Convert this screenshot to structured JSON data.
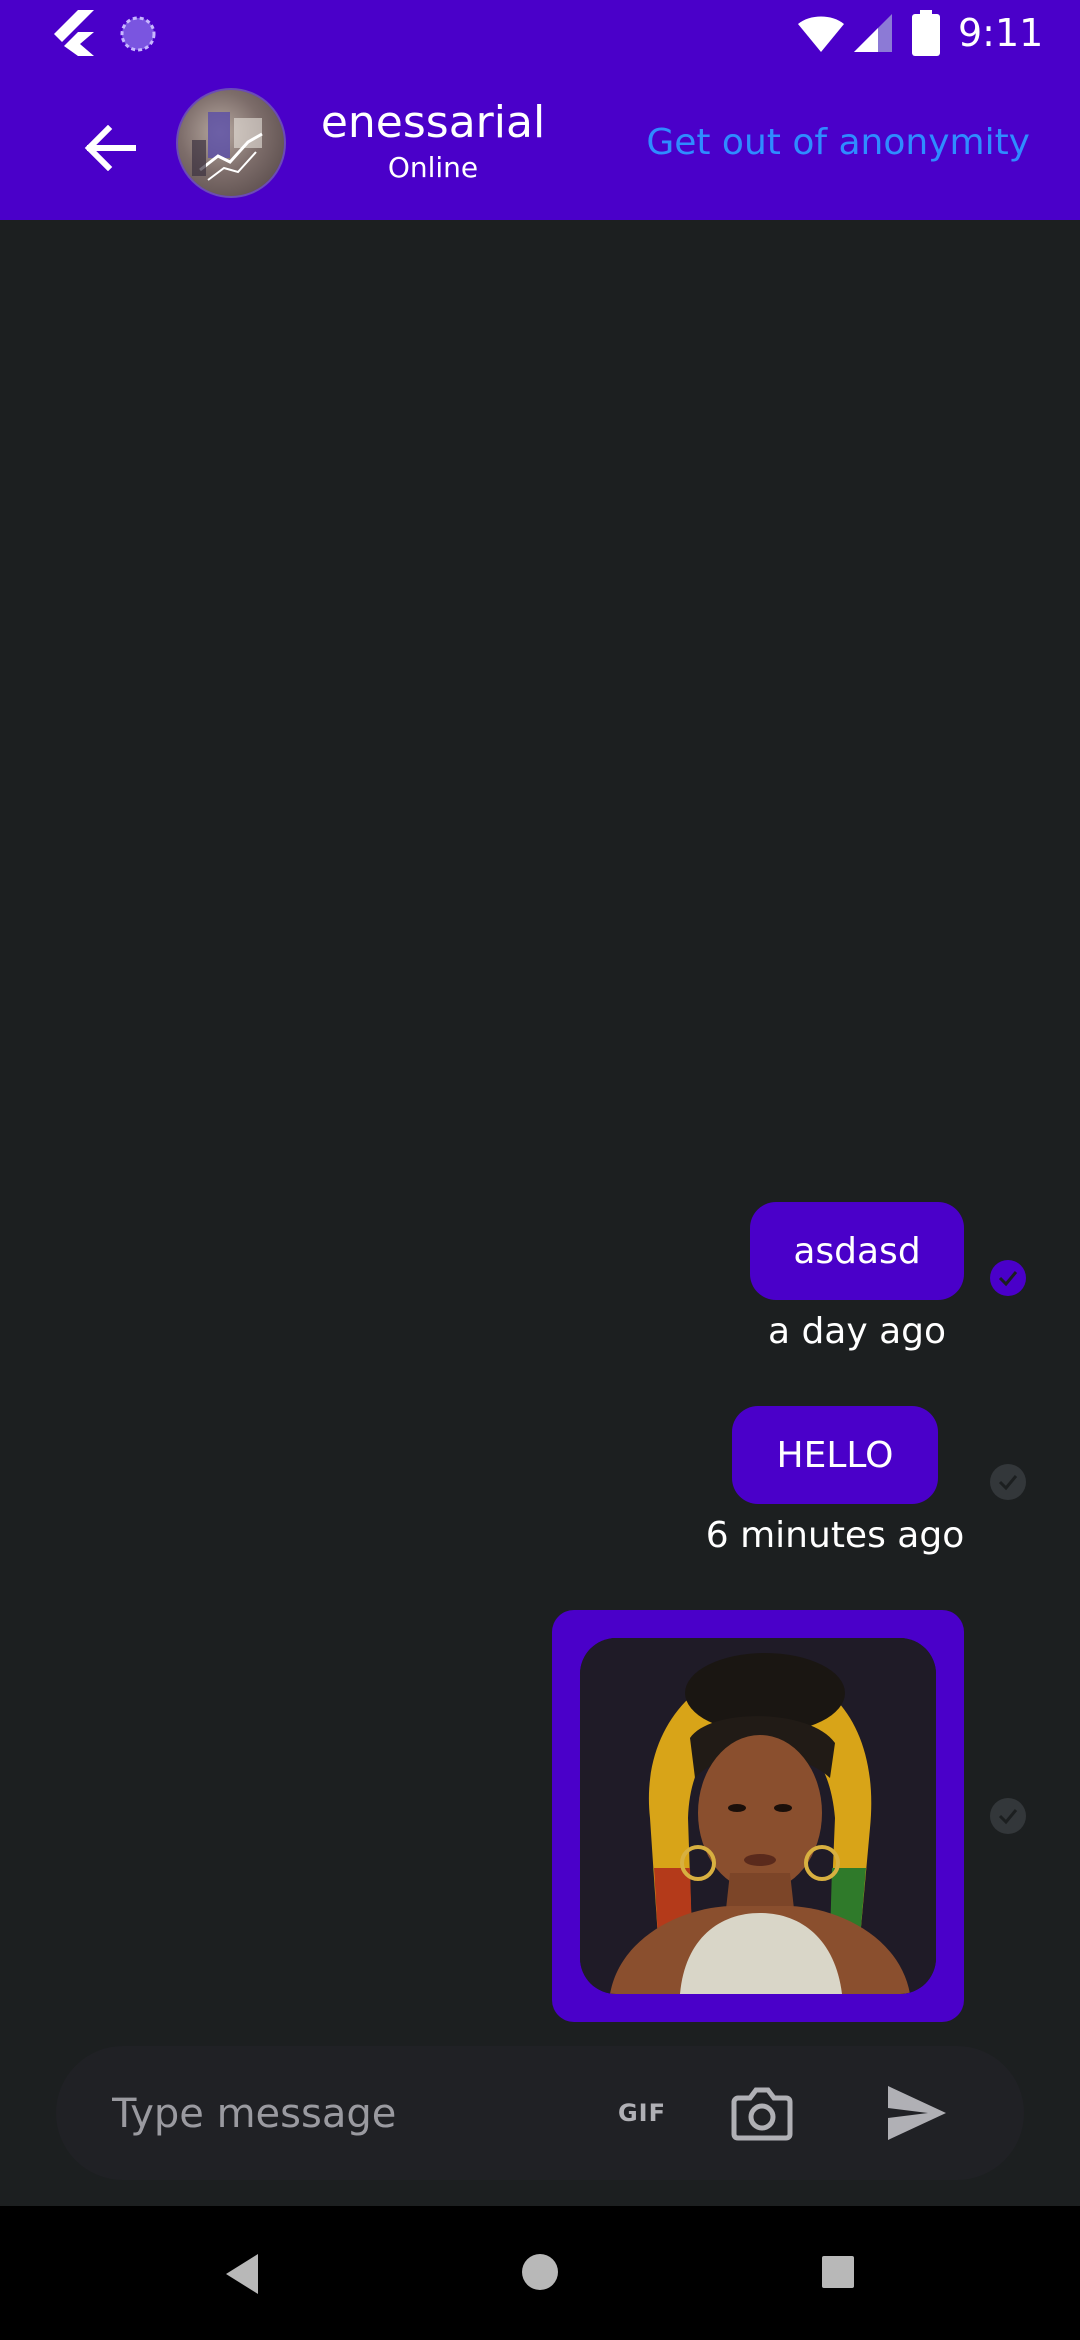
{
  "status_bar": {
    "time": "9:11",
    "icons": [
      "flutter-icon",
      "loading-spinner-icon",
      "wifi-icon",
      "signal-icon",
      "battery-icon"
    ]
  },
  "header": {
    "contact_name": "enessarial",
    "contact_status": "Online",
    "anonymity_action": "Get out of anonymity",
    "back_icon": "arrow-left-icon"
  },
  "messages": [
    {
      "type": "text",
      "text": "asdasd",
      "time": "a day ago",
      "status": "read"
    },
    {
      "type": "text",
      "text": "HELLO",
      "time": "6 minutes ago",
      "status": "sent"
    },
    {
      "type": "image",
      "status": "sent"
    }
  ],
  "composer": {
    "placeholder": "Type message",
    "gif_label": "GIF",
    "icons": [
      "gif-icon",
      "camera-icon",
      "send-icon"
    ]
  },
  "nav_bar": {
    "icons": [
      "nav-back-icon",
      "nav-home-icon",
      "nav-recents-icon"
    ]
  },
  "colors": {
    "primary": "#4a00c9",
    "background": "#1c1f20",
    "link": "#2f8cff",
    "composer_bg": "#202125",
    "unread_mark": "#33373a"
  }
}
